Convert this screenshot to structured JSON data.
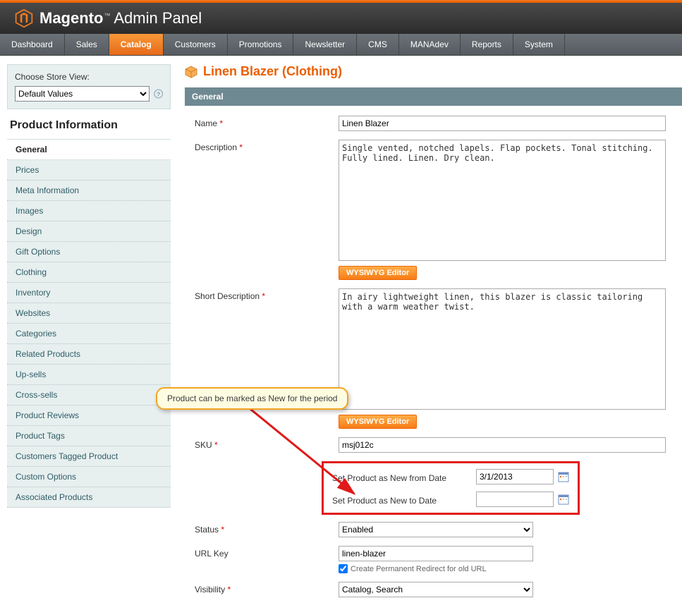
{
  "header": {
    "brand": "Magento",
    "subtitle": "Admin Panel"
  },
  "nav": {
    "items": [
      "Dashboard",
      "Sales",
      "Catalog",
      "Customers",
      "Promotions",
      "Newsletter",
      "CMS",
      "MANAdev",
      "Reports",
      "System"
    ],
    "activeIndex": 2
  },
  "storeView": {
    "label": "Choose Store View:",
    "selected": "Default Values"
  },
  "sectionTitle": "Product Information",
  "sideNav": {
    "items": [
      "General",
      "Prices",
      "Meta Information",
      "Images",
      "Design",
      "Gift Options",
      "Clothing",
      "Inventory",
      "Websites",
      "Categories",
      "Related Products",
      "Up-sells",
      "Cross-sells",
      "Product Reviews",
      "Product Tags",
      "Customers Tagged Product",
      "Custom Options",
      "Associated Products"
    ],
    "activeIndex": 0
  },
  "pageTitle": "Linen Blazer (Clothing)",
  "panel": {
    "title": "General"
  },
  "form": {
    "name": {
      "label": "Name",
      "value": "Linen Blazer"
    },
    "description": {
      "label": "Description",
      "value": "Single vented, notched lapels. Flap pockets. Tonal stitching. Fully lined. Linen. Dry clean."
    },
    "shortDescription": {
      "label": "Short Description",
      "value": "In airy lightweight linen, this blazer is classic tailoring with a warm weather twist."
    },
    "wysiwyg": "WYSIWYG Editor",
    "sku": {
      "label": "SKU",
      "value": "msj012c"
    },
    "newFrom": {
      "label": "Set Product as New from Date",
      "value": "3/1/2013"
    },
    "newTo": {
      "label": "Set Product as New to Date",
      "value": ""
    },
    "status": {
      "label": "Status",
      "value": "Enabled"
    },
    "urlKey": {
      "label": "URL Key",
      "value": "linen-blazer",
      "redirectLabel": "Create Permanent Redirect for old URL"
    },
    "visibility": {
      "label": "Visibility",
      "value": "Catalog, Search"
    }
  },
  "callout": "Product can be marked as New for the period"
}
